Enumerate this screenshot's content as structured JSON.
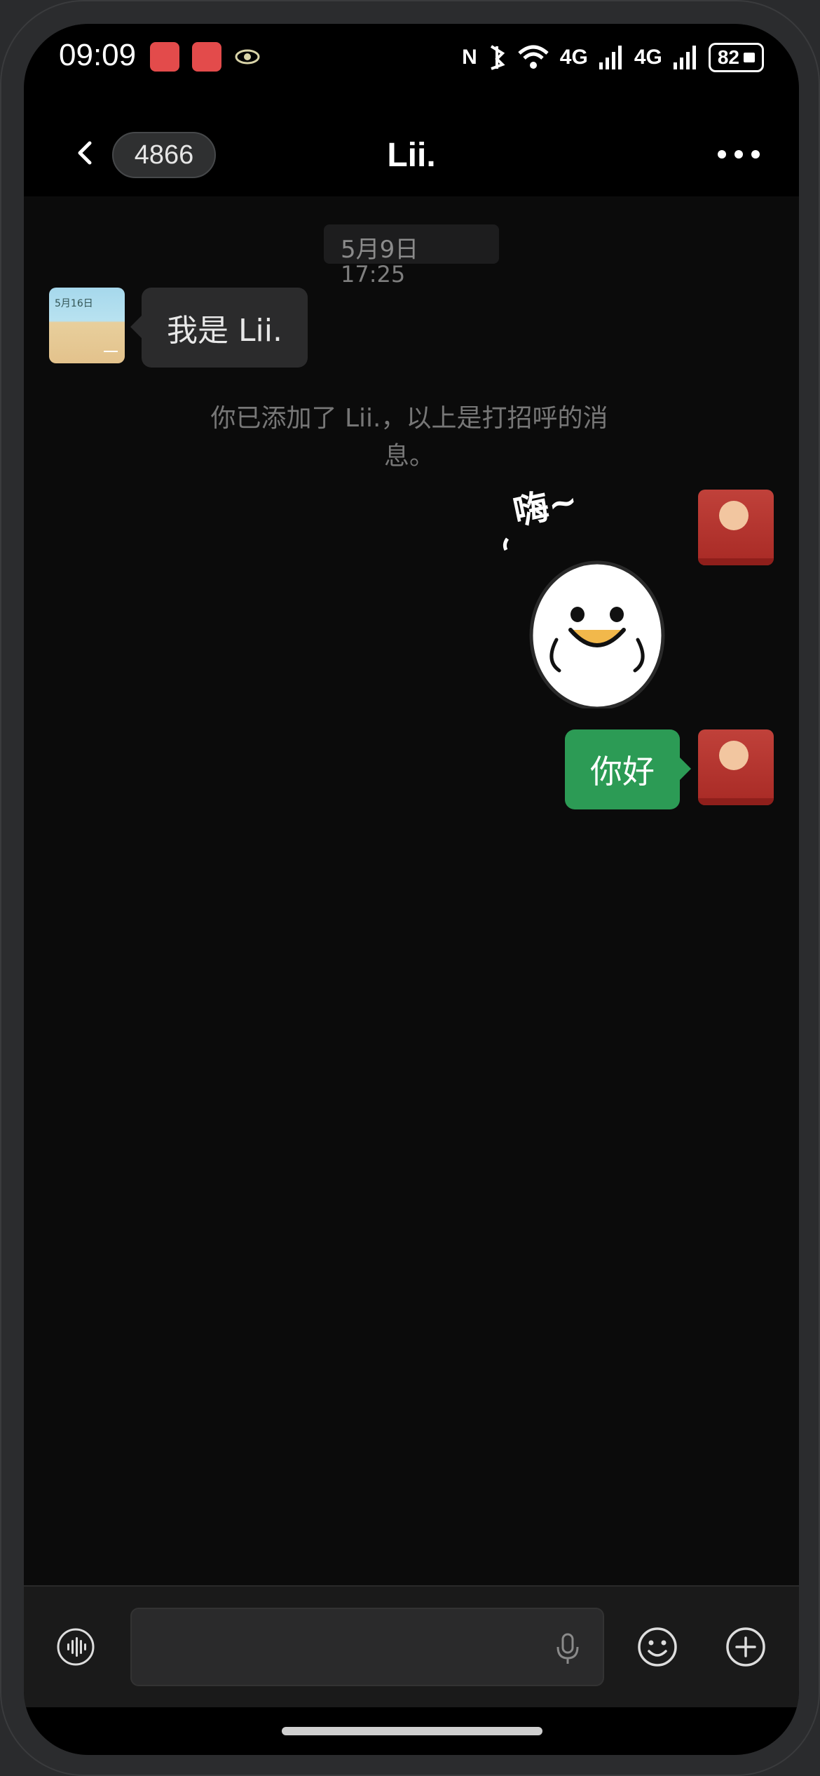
{
  "status_bar": {
    "time": "09:09",
    "nfc": "N",
    "network_1": "4G",
    "network_2": "4G",
    "battery": "82"
  },
  "header": {
    "unread_count": "4866",
    "title": "Lii."
  },
  "messages": {
    "date": "5月9日",
    "time": "17:25",
    "contact_avatar_text": "5月16日",
    "incoming_text": "我是 Lii.",
    "system_notice": "你已添加了 Lii.，以上是打招呼的消息。",
    "sticker_caption": "嗨~",
    "outgoing_text": "你好"
  },
  "colors": {
    "accent_green": "#2c9b55",
    "background": "#0b0b0b"
  }
}
